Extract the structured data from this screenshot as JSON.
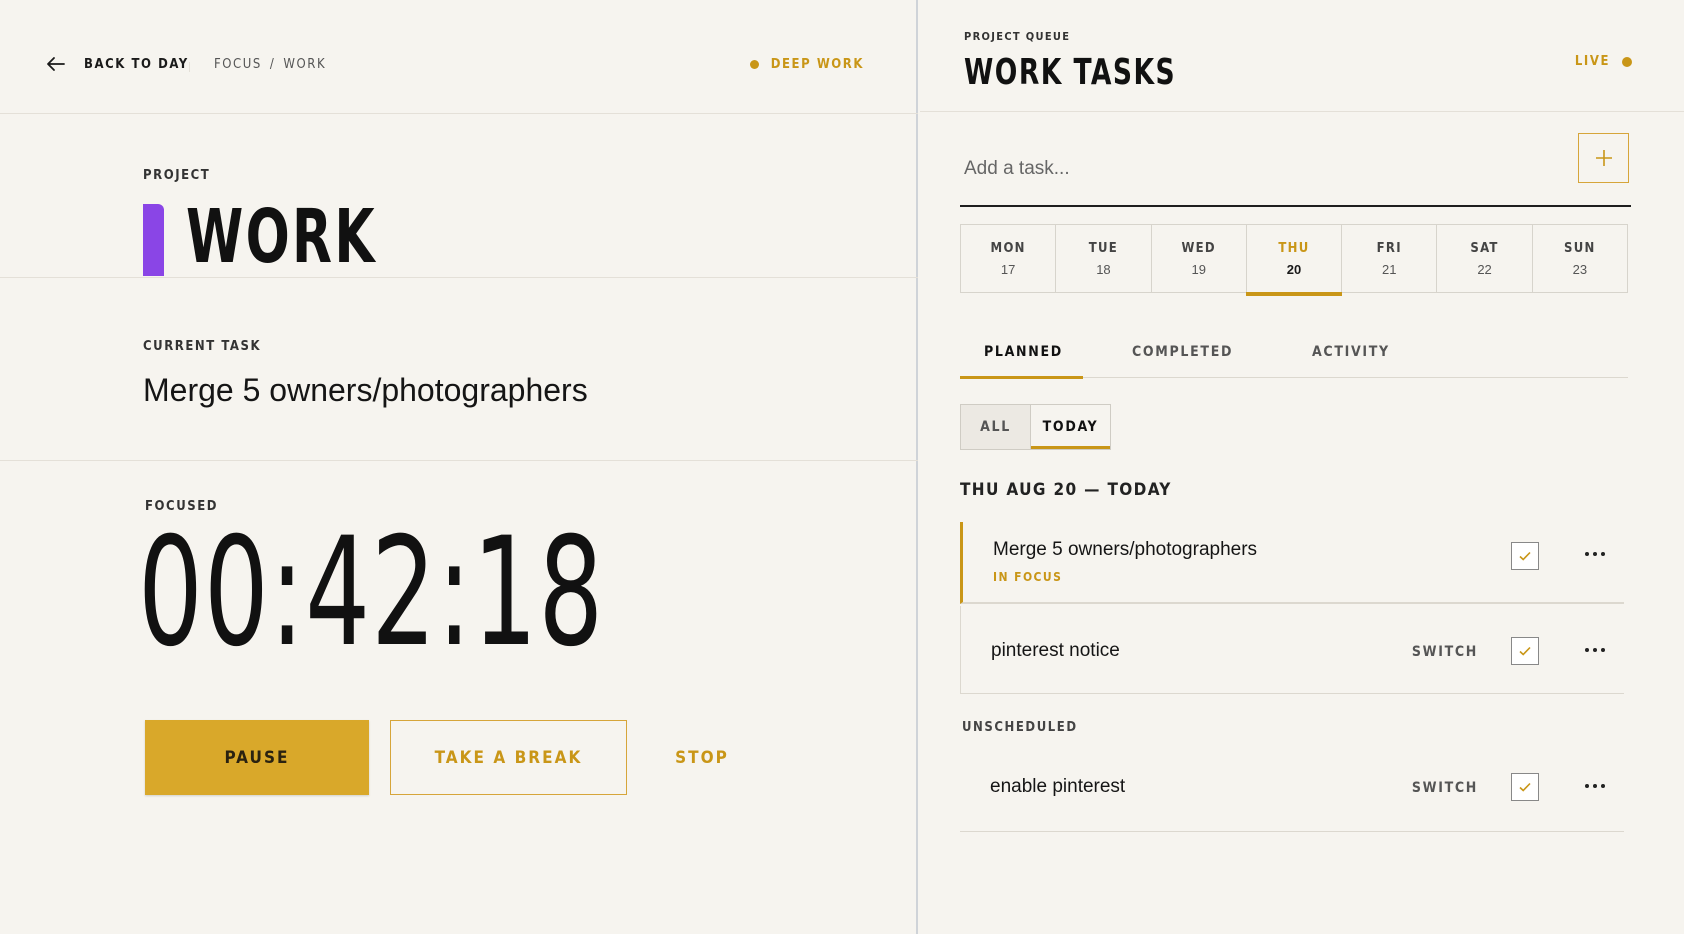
{
  "left": {
    "back_label": "BACK TO DAY",
    "breadcrumb": [
      "FOCUS",
      "/",
      "WORK"
    ],
    "mode_label": "DEEP WORK",
    "project_label": "PROJECT",
    "project_name": "WORK",
    "project_color": "#8a45e6",
    "current_task_label": "CURRENT TASK",
    "current_task": "Merge 5 owners/photographers",
    "focused_label": "FOCUSED",
    "timer": "00:42:18",
    "pause_label": "PAUSE",
    "break_label": "TAKE A BREAK",
    "stop_label": "STOP"
  },
  "right": {
    "queue_label": "PROJECT QUEUE",
    "title": "WORK TASKS",
    "live_label": "LIVE",
    "add_placeholder": "Add a task...",
    "days": [
      {
        "name": "MON",
        "date": "17"
      },
      {
        "name": "TUE",
        "date": "18"
      },
      {
        "name": "WED",
        "date": "19"
      },
      {
        "name": "THU",
        "date": "20"
      },
      {
        "name": "FRI",
        "date": "21"
      },
      {
        "name": "SAT",
        "date": "22"
      },
      {
        "name": "SUN",
        "date": "23"
      }
    ],
    "active_day": "THU",
    "tabs": {
      "planned": "PLANNED",
      "completed": "COMPLETED",
      "activity": "ACTIVITY"
    },
    "filters": {
      "all": "ALL",
      "today": "TODAY"
    },
    "date_heading": "THU AUG 20 — TODAY",
    "tasks": [
      {
        "title": "Merge 5 owners/photographers",
        "sub": "IN FOCUS"
      },
      {
        "title": "pinterest notice",
        "switch": "SWITCH"
      }
    ],
    "unscheduled_label": "UNSCHEDULED",
    "unscheduled": [
      {
        "title": "enable pinterest",
        "switch": "SWITCH"
      }
    ]
  },
  "colors": {
    "accent": "#c99617",
    "button_fill": "#d9a82a",
    "background": "#f6f4ef"
  }
}
